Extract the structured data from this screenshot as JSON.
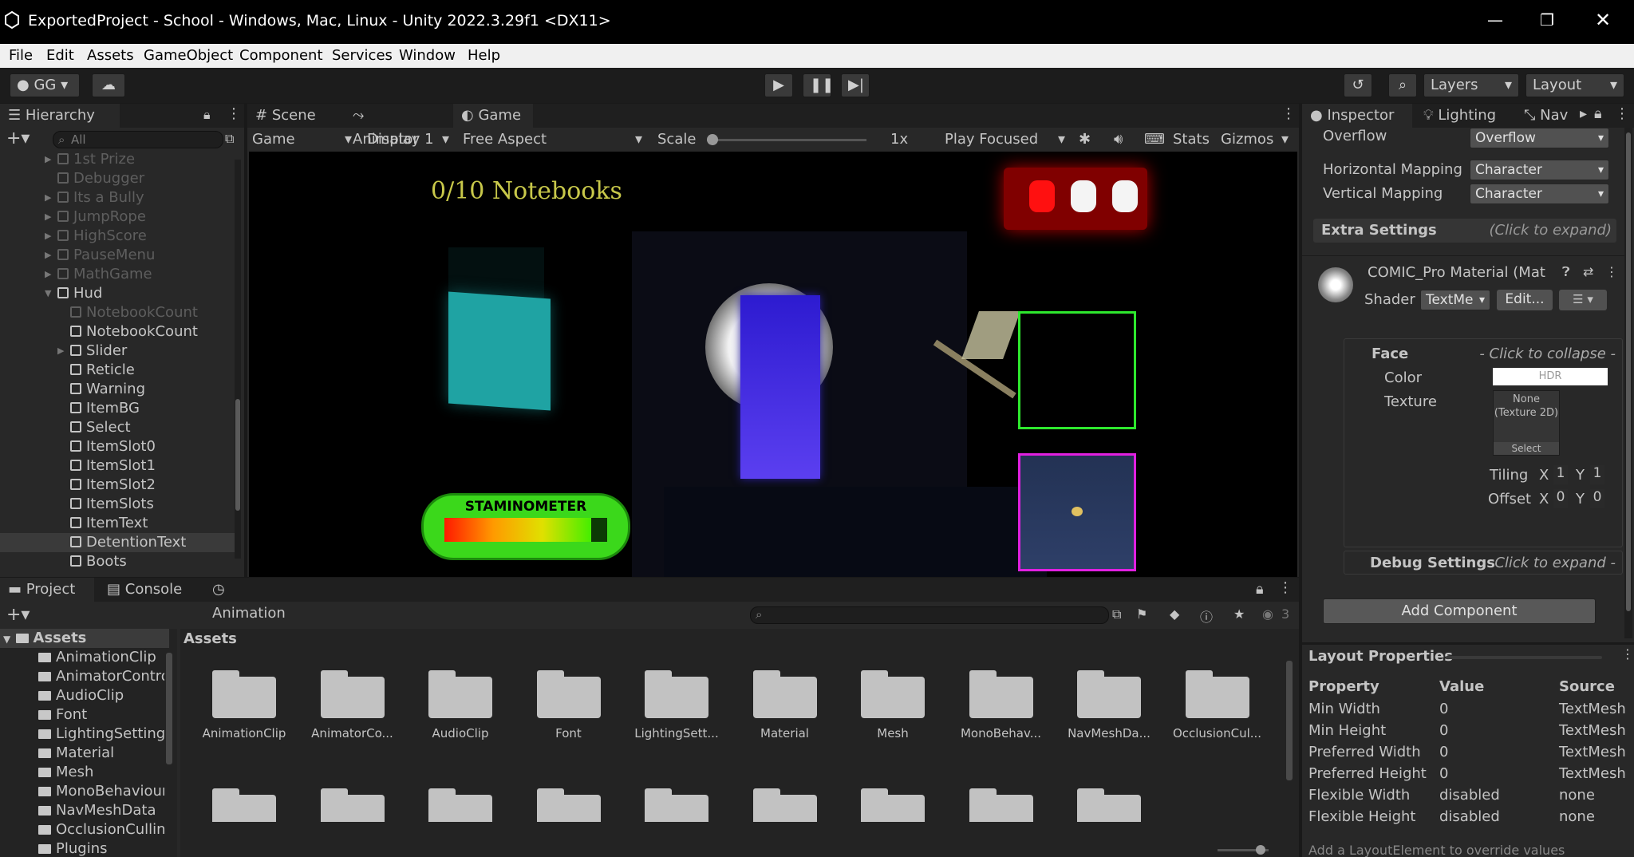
{
  "window": {
    "title": "ExportedProject - School - Windows, Mac, Linux - Unity 2022.3.29f1 <DX11>",
    "min_glyph": "—",
    "max_glyph": "❐",
    "close_glyph": "✕"
  },
  "menu": [
    "File",
    "Edit",
    "Assets",
    "GameObject",
    "Component",
    "Services",
    "Window",
    "Help"
  ],
  "toolbar": {
    "account": "GG",
    "layers": "Layers",
    "layout": "Layout"
  },
  "hierarchy": {
    "tab": "Hierarchy",
    "search_placeholder": "All",
    "items": [
      {
        "label": "1st Prize",
        "arrow": "▶",
        "dim": true,
        "indent": 1
      },
      {
        "label": "Debugger",
        "arrow": "",
        "dim": true,
        "indent": 1
      },
      {
        "label": "Its a Bully",
        "arrow": "▶",
        "dim": true,
        "indent": 1
      },
      {
        "label": "JumpRope",
        "arrow": "▶",
        "dim": true,
        "indent": 1
      },
      {
        "label": "HighScore",
        "arrow": "▶",
        "dim": true,
        "indent": 1
      },
      {
        "label": "PauseMenu",
        "arrow": "▶",
        "dim": true,
        "indent": 1
      },
      {
        "label": "MathGame",
        "arrow": "▶",
        "dim": true,
        "indent": 1
      },
      {
        "label": "Hud",
        "arrow": "▼",
        "dim": false,
        "indent": 1
      },
      {
        "label": "NotebookCount",
        "arrow": "",
        "dim": true,
        "indent": 2
      },
      {
        "label": "NotebookCount",
        "arrow": "",
        "dim": false,
        "indent": 2
      },
      {
        "label": "Slider",
        "arrow": "▶",
        "dim": false,
        "indent": 2
      },
      {
        "label": "Reticle",
        "arrow": "",
        "dim": false,
        "indent": 2
      },
      {
        "label": "Warning",
        "arrow": "",
        "dim": false,
        "indent": 2
      },
      {
        "label": "ItemBG",
        "arrow": "",
        "dim": false,
        "indent": 2
      },
      {
        "label": "Select",
        "arrow": "",
        "dim": false,
        "indent": 2
      },
      {
        "label": "ItemSlot0",
        "arrow": "",
        "dim": false,
        "indent": 2
      },
      {
        "label": "ItemSlot1",
        "arrow": "",
        "dim": false,
        "indent": 2
      },
      {
        "label": "ItemSlot2",
        "arrow": "",
        "dim": false,
        "indent": 2
      },
      {
        "label": "ItemSlots",
        "arrow": "",
        "dim": false,
        "indent": 2
      },
      {
        "label": "ItemText",
        "arrow": "",
        "dim": false,
        "indent": 2
      },
      {
        "label": "DetentionText",
        "arrow": "",
        "dim": false,
        "indent": 2
      },
      {
        "label": "Boots",
        "arrow": "",
        "dim": false,
        "indent": 2
      }
    ]
  },
  "game_view": {
    "tabs": [
      "Scene",
      "Animator",
      "Game"
    ],
    "display_mode": "Game",
    "display": "Display 1",
    "aspect": "Free Aspect",
    "scale_label": "Scale",
    "scale_value": "1x",
    "play_focused": "Play Focused",
    "stats": "Stats",
    "gizmos": "Gizmos",
    "notebooks": "0/10 Notebooks",
    "stamina_label": "STAMINOMETER",
    "stamina_level": 0.9
  },
  "inspector": {
    "tabs": [
      "Inspector",
      "Lighting",
      "Nav"
    ],
    "overflow_label": "Overflow",
    "overflow_value": "Overflow",
    "hmap_label": "Horizontal Mapping",
    "hmap_value": "Character",
    "vmap_label": "Vertical Mapping",
    "vmap_value": "Character",
    "extra_settings": "Extra Settings",
    "extra_hint": "(Click to expand)",
    "material_name": "COMIC_Pro Material (Mat",
    "shader_label": "Shader",
    "shader_value": "TextMe",
    "edit_button": "Edit...",
    "face_label": "Face",
    "face_hint": "- Click to collapse -",
    "color_label": "Color",
    "color_value": "HDR",
    "texture_label": "Texture",
    "texture_value": "None (Texture 2D)",
    "texture_select": "Select",
    "tiling_label": "Tiling",
    "tiling_x": "1",
    "tiling_y": "1",
    "offset_label": "Offset",
    "offset_x": "0",
    "offset_y": "0",
    "x_label": "X",
    "y_label": "Y",
    "debug_label": "Debug Settings",
    "debug_hint": "Click to expand -",
    "add_component": "Add Component"
  },
  "layout_props": {
    "title": "Layout Properties",
    "headers": [
      "Property",
      "Value",
      "Source"
    ],
    "rows": [
      [
        "Min Width",
        "0",
        "TextMesh"
      ],
      [
        "Min Height",
        "0",
        "TextMesh"
      ],
      [
        "Preferred Width",
        "0",
        "TextMesh"
      ],
      [
        "Preferred Height",
        "0",
        "TextMesh"
      ],
      [
        "Flexible Width",
        "disabled",
        "none"
      ],
      [
        "Flexible Height",
        "disabled",
        "none"
      ]
    ],
    "footer": "Add a LayoutElement to override values"
  },
  "project": {
    "tabs": [
      "Project",
      "Console",
      "Animation"
    ],
    "hidden_count": "3",
    "tree_root": "Assets",
    "tree": [
      "AnimationClip",
      "AnimatorContro",
      "AudioClip",
      "Font",
      "LightingSettings",
      "Material",
      "Mesh",
      "MonoBehaviour",
      "NavMeshData",
      "OcclusionCullin",
      "Plugins"
    ],
    "breadcrumb": "Assets",
    "grid": [
      "AnimationClip",
      "AnimatorCo...",
      "AudioClip",
      "Font",
      "LightingSett...",
      "Material",
      "Mesh",
      "MonoBehav...",
      "NavMeshDa...",
      "OcclusionCul..."
    ]
  },
  "colors": {
    "notebook_text": "#c8c84a",
    "green_box": "#2ee82e",
    "magenta_box": "#e020e0"
  }
}
